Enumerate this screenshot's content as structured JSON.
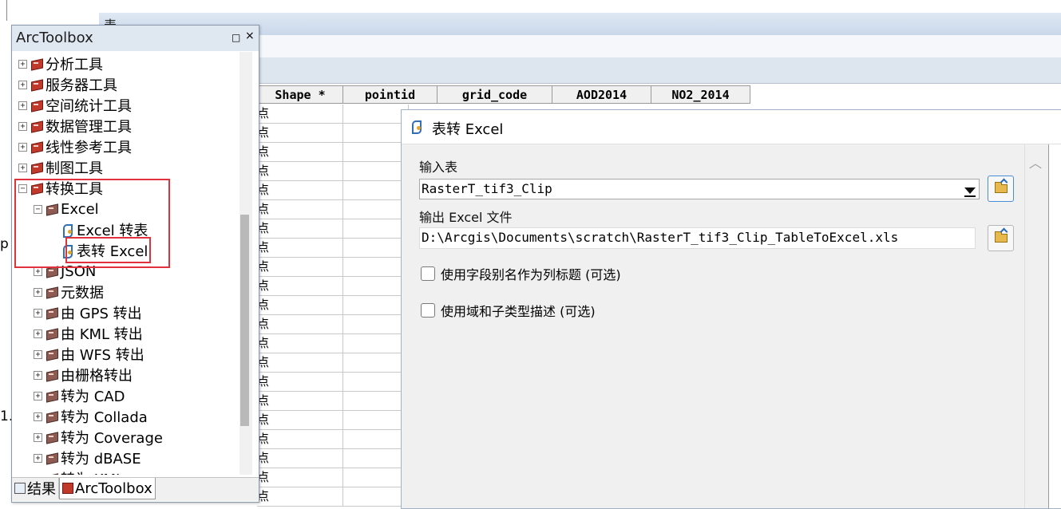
{
  "background": {
    "left_clip_1": "p",
    "left_clip_2": "1.",
    "table_title": "表"
  },
  "attribute_table": {
    "columns": [
      "Shape *",
      "pointid",
      "grid_code",
      "AOD2014",
      "NO2_2014"
    ],
    "row_shape_value": "点",
    "row_count": 21
  },
  "toolbox": {
    "title": "ArcToolbox",
    "pin_glyph": "□",
    "close_glyph": "×",
    "items": [
      {
        "label": "分析工具",
        "expander": "+",
        "icon": "toolbox"
      },
      {
        "label": "服务器工具",
        "expander": "+",
        "icon": "toolbox"
      },
      {
        "label": "空间统计工具",
        "expander": "+",
        "icon": "toolbox"
      },
      {
        "label": "数据管理工具",
        "expander": "+",
        "icon": "toolbox"
      },
      {
        "label": "线性参考工具",
        "expander": "+",
        "icon": "toolbox"
      },
      {
        "label": "制图工具",
        "expander": "+",
        "icon": "toolbox"
      },
      {
        "label": "转换工具",
        "expander": "−",
        "icon": "toolbox"
      },
      {
        "label": "Excel",
        "expander": "−",
        "icon": "toolset"
      },
      {
        "label": "Excel 转表",
        "icon": "script"
      },
      {
        "label": "表转 Excel",
        "icon": "script"
      },
      {
        "label": "JSON",
        "expander": "+",
        "icon": "toolset"
      },
      {
        "label": "元数据",
        "expander": "+",
        "icon": "toolset"
      },
      {
        "label": "由 GPS 转出",
        "expander": "+",
        "icon": "toolset"
      },
      {
        "label": "由 KML 转出",
        "expander": "+",
        "icon": "toolset"
      },
      {
        "label": "由 WFS 转出",
        "expander": "+",
        "icon": "toolset"
      },
      {
        "label": "由栅格转出",
        "expander": "+",
        "icon": "toolset"
      },
      {
        "label": "转为 CAD",
        "expander": "+",
        "icon": "toolset"
      },
      {
        "label": "转为 Collada",
        "expander": "+",
        "icon": "toolset"
      },
      {
        "label": "转为 Coverage",
        "expander": "+",
        "icon": "toolset"
      },
      {
        "label": "转为 dBASE",
        "expander": "+",
        "icon": "toolset"
      },
      {
        "label": "转为 KML",
        "expander": "+",
        "icon": "toolset"
      }
    ],
    "tabs": [
      {
        "label": "结果"
      },
      {
        "label": "ArcToolbox"
      }
    ]
  },
  "dialog": {
    "title": "表转 Excel",
    "input_table_label": "输入表",
    "input_table_value": "RasterT_tif3_Clip",
    "output_file_label": "输出 Excel 文件",
    "output_file_value": "D:\\Arcgis\\Documents\\scratch\\RasterT_tif3_Clip_TableToExcel.xls",
    "checkbox_alias": "使用字段别名作为列标题 (可选)",
    "checkbox_domain": "使用域和子类型描述 (可选)",
    "scroll_up_glyph": "︿"
  },
  "colors": {
    "highlight": "#e0313c",
    "toolbox_icon": "#c0392b",
    "title_bar": "#dfe7f1"
  }
}
